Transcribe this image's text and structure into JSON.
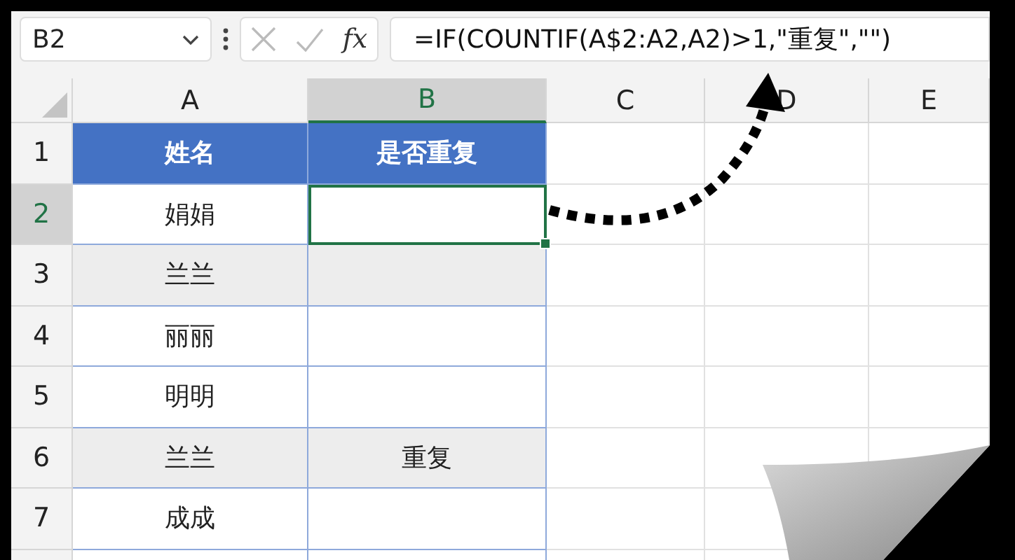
{
  "name_box": {
    "value": "B2"
  },
  "formula_bar": {
    "function_label": "fx",
    "value": "=IF(COUNTIF(A$2:A2,A2)>1,\"重复\",\"\")"
  },
  "columns": [
    {
      "label": "A",
      "selected": false
    },
    {
      "label": "B",
      "selected": true
    },
    {
      "label": "C",
      "selected": false
    },
    {
      "label": "D",
      "selected": false
    },
    {
      "label": "E",
      "selected": false
    }
  ],
  "rows": [
    {
      "number": "1",
      "selected": false,
      "kind": "header",
      "cells": [
        {
          "text": "姓名",
          "active": false
        },
        {
          "text": "是否重复",
          "active": false
        }
      ]
    },
    {
      "number": "2",
      "selected": true,
      "kind": "data",
      "highlighted": false,
      "cells": [
        {
          "text": "娟娟",
          "active": false
        },
        {
          "text": "",
          "active": true
        }
      ]
    },
    {
      "number": "3",
      "selected": false,
      "kind": "data",
      "highlighted": true,
      "cells": [
        {
          "text": "兰兰",
          "active": false
        },
        {
          "text": "",
          "active": false
        }
      ]
    },
    {
      "number": "4",
      "selected": false,
      "kind": "data",
      "highlighted": false,
      "cells": [
        {
          "text": "丽丽",
          "active": false
        },
        {
          "text": "",
          "active": false
        }
      ]
    },
    {
      "number": "5",
      "selected": false,
      "kind": "data",
      "highlighted": false,
      "cells": [
        {
          "text": "明明",
          "active": false
        },
        {
          "text": "",
          "active": false
        }
      ]
    },
    {
      "number": "6",
      "selected": false,
      "kind": "data",
      "highlighted": true,
      "cells": [
        {
          "text": "兰兰",
          "active": false
        },
        {
          "text": "重复",
          "active": false
        }
      ]
    },
    {
      "number": "7",
      "selected": false,
      "kind": "data",
      "highlighted": false,
      "cells": [
        {
          "text": "成成",
          "active": false
        },
        {
          "text": "",
          "active": false
        }
      ]
    }
  ]
}
